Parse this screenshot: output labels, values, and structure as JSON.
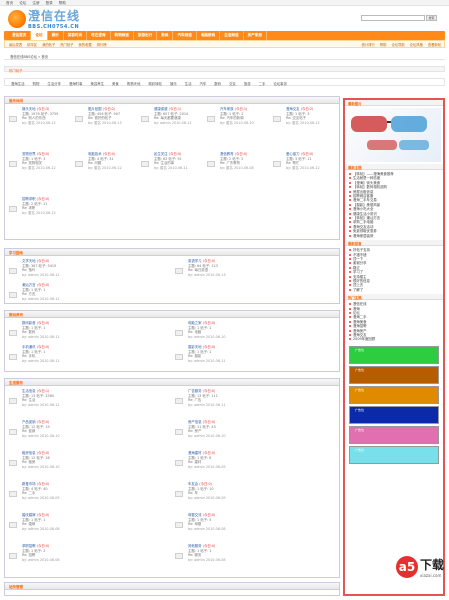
{
  "topbar": [
    "首页",
    "论坛",
    "注册",
    "登录",
    "帮助"
  ],
  "logo": {
    "cn": "澄信在线",
    "en": "BBS.CH0754.CN"
  },
  "search": {
    "button": "搜索"
  },
  "nav": [
    "澄信首页",
    "论坛",
    "娱乐",
    "美容时尚",
    "吃在澄海",
    "购物频道",
    "旅游出行",
    "数码",
    "汽车频道",
    "电脑数码",
    "生活频道",
    "房产家居"
  ],
  "subnav": {
    "left": [
      "最后发表",
      "精华区",
      "我的帖子",
      "热门帖子",
      "我的收藏",
      "排行榜"
    ],
    "right": [
      "统计排行",
      "帮助",
      "论坛导航",
      "论坛风格",
      "查看新帖"
    ]
  },
  "crumb": "澄信在线BBS论坛 » 首页",
  "bar2": "热门帖子",
  "cats": [
    "澄海生活",
    "购物",
    "生活分享",
    "澄海时事",
    "美容养生",
    "美食",
    "购物天地",
    "精彩转帖",
    "娱乐",
    "生活",
    "汽车",
    "数码",
    "交友",
    "旅游",
    "二手",
    "论坛事务"
  ],
  "sections": [
    {
      "title": "娱乐休闲",
      "cells": [
        {
          "ttl": "娱乐天地",
          "new": "(今日:3)",
          "meta": "主题: 1976 帖子: 3759",
          "last": "Re: 别人的东西",
          "by": "by: 匿名 2010-06-12"
        },
        {
          "ttl": "图片贴图",
          "new": "(今日:2)",
          "meta": "主题: 456 帖子: 907",
          "last": "Re: 很好的帖子",
          "by": "by: 匿名 2010-06-13"
        },
        {
          "ttl": "健康保健",
          "new": "(今日:1)",
          "meta": "主题: 657 帖子: 2014",
          "last": "Re: 每天都要健康",
          "by": "by: admin 2010-06-12"
        },
        {
          "ttl": "汽车家族",
          "new": "(今日:1)",
          "meta": "主题: 1 帖子: 2",
          "last": "Re: 汽车的新闻",
          "by": "by: 匿名 2010-06-10"
        },
        {
          "ttl": "澄海交友",
          "new": "(今日:2)",
          "meta": "主题: 1 帖子: 3",
          "last": "Re: 交友帖子",
          "by": "by: 匿名 2010-06-12"
        },
        {
          "ttl": "宠物世界",
          "new": "(今日:0)",
          "meta": "主题: 1 帖子: 3",
          "last": "Re: 宠物相关",
          "by": "by: 匿名 2010-06-12"
        },
        {
          "ttl": "电脑技术",
          "new": "(今日:0)",
          "meta": "主题: 4 帖子: 31",
          "last": "Re: 问题",
          "by": "by: 匿名 2010-06-12"
        },
        {
          "ttl": "民生关注",
          "new": "(今日:0)",
          "meta": "主题: 63 帖子: 91",
          "last": "Re: 生活的事",
          "by": "by: 匿名 2010-06-11"
        },
        {
          "ttl": "澄信教育",
          "new": "(今日:0)",
          "meta": "主题: 2 帖子: 2",
          "last": "Re: 广东教育",
          "by": "by: 匿名 2010-06-08"
        },
        {
          "ttl": "爱心接力",
          "new": "(今日:0)",
          "meta": "主题: 3 帖子: 11",
          "last": "Re: 帮忙",
          "by": "by: 匿名 2010-06-12"
        },
        {
          "ttl": "招聘求职",
          "new": "(今日:0)",
          "meta": "主题: 2 帖子: 21",
          "last": "Re: 求职",
          "by": "by: 匿名 2010-06-12"
        }
      ]
    },
    {
      "title": "学习园地",
      "cells": [
        {
          "ttl": "文学天地",
          "new": "(今日:0)",
          "meta": "主题: 367 帖子: 3415",
          "last": "Re: 落叶",
          "by": "by: admin 2010-06-12"
        },
        {
          "ttl": "英语学习",
          "new": "(今日:0)",
          "meta": "主题: 64 帖子: 123",
          "last": "Re: 每日英语",
          "by": "by: admin 2010-06-13"
        },
        {
          "ttl": "潮汕方言",
          "new": "(今日:0)",
          "meta": "主题: 1 帖子: 1",
          "last": "Re: 方言",
          "by": "by: admin 2010-06-12"
        }
      ]
    },
    {
      "title": "数码资讯",
      "cells": [
        {
          "ttl": "数码影音",
          "new": "(今日:0)",
          "meta": "主题: 1 帖子: 1",
          "last": "Re: 数码",
          "by": "by: admin 2010-06-11"
        },
        {
          "ttl": "电脑之家",
          "new": "(今日:0)",
          "meta": "主题: 1 帖子: 1",
          "last": "Re: 电脑",
          "by": "by: admin 2010-06-10"
        },
        {
          "ttl": "手机通讯",
          "new": "(今日:0)",
          "meta": "主题: 1 帖子: 1",
          "last": "Re: 手机",
          "by": "by: admin 2010-06-11"
        },
        {
          "ttl": "摄影天地",
          "new": "(今日:0)",
          "meta": "主题: 1 帖子: 1",
          "last": "Re: 摄影",
          "by": "by: admin 2010-06-11"
        }
      ]
    },
    {
      "title": "生活服务",
      "cells": [
        {
          "ttl": "生活信息",
          "new": "(今日:1)",
          "meta": "主题: 13 帖子: 1580",
          "last": "Re: 生活",
          "by": "by: admin 2010-06-12"
        },
        {
          "ttl": "广告服务",
          "new": "(今日:0)",
          "meta": "主题: 13 帖子: 111",
          "last": "Re: 广告",
          "by": "by: admin 2010-06-11"
        },
        {
          "ttl": "产品促销",
          "new": "(今日:0)",
          "meta": "主题: 12 帖子: 19",
          "last": "Re: 促销",
          "by": "by: admin 2010-06-10"
        },
        {
          "ttl": "房产信息",
          "new": "(今日:0)",
          "meta": "主题: 11 帖子: 43",
          "last": "Re: 房产",
          "by": "by: admin 2010-06-10"
        },
        {
          "ttl": "租房信息",
          "new": "(今日:0)",
          "meta": "主题: 12 帖子: 26",
          "last": "Re: 租房",
          "by": "by: admin 2010-06-10"
        },
        {
          "ttl": "澄海建材",
          "new": "(今日:0)",
          "meta": "主题: 1 帖子: 8",
          "last": "Re: 建材",
          "by": "by: admin 2010-06-09"
        },
        {
          "ttl": "跳蚤市场",
          "new": "(今日:0)",
          "meta": "主题: 4 帖子: 40",
          "last": "Re: 二手",
          "by": "by: admin 2010-06-09"
        },
        {
          "ttl": "车友会",
          "new": "(今日:0)",
          "meta": "主题: 1 帖子: 10",
          "last": "Re: 车",
          "by": "by: admin 2010-06-09"
        },
        {
          "ttl": "婚庆婚嫁",
          "new": "(今日:0)",
          "meta": "主题: 1 帖子: 1",
          "last": "Re: 婚嫁",
          "by": "by: admin 2010-06-08"
        },
        {
          "ttl": "母婴交流",
          "new": "(今日:0)",
          "meta": "主题: 1 帖子: 5",
          "last": "Re: 母婴",
          "by": "by: admin 2010-06-08"
        },
        {
          "ttl": "求职招聘",
          "new": "(今日:0)",
          "meta": "主题: 1 帖子: 2",
          "last": "Re: 招聘",
          "by": "by: admin 2010-06-08"
        },
        {
          "ttl": "其他服务",
          "new": "(今日:0)",
          "meta": "主题: 1 帖子: 1",
          "last": "Re: 服务",
          "by": "by: admin 2010-06-08"
        }
      ]
    }
  ],
  "section5": "站务管理",
  "right": {
    "head1": "最新图片",
    "head2": "最新主题",
    "list2": [
      "【转帖】——澄海美食推荐",
      "生活就是一种态度",
      "【澄海】街头美食",
      "【转帖】数码相机选购",
      "房屋出租信息",
      "招聘网店客服",
      "澄海二手车交易",
      "【摄影】美丽风景",
      "澄海小吃大全",
      "健康生活小常识",
      "【转帖】潮汕方言",
      "求购二手电脑",
      "澄海交友活动",
      "免费领取优惠券",
      "澄海家居装修"
    ],
    "head3": "最新回复",
    "list3": [
      "好帖子支持",
      "不错不错",
      "顶一下",
      "谢谢分享",
      "路过",
      "学习了",
      "支持楼主",
      "很好的信息",
      "顶上去",
      "了解了"
    ],
    "head4": "热门主题",
    "list4": [
      "澄信在线",
      "澄海",
      "论坛",
      "澄海二手",
      "澄海美食",
      "澄海招聘",
      "澄海房产",
      "澄海交友",
      "2009年度回顾"
    ],
    "adlabel": "广告位"
  },
  "watermark": {
    "zh": "下载",
    "en": "xiazai.com",
    "badge": "a5"
  }
}
